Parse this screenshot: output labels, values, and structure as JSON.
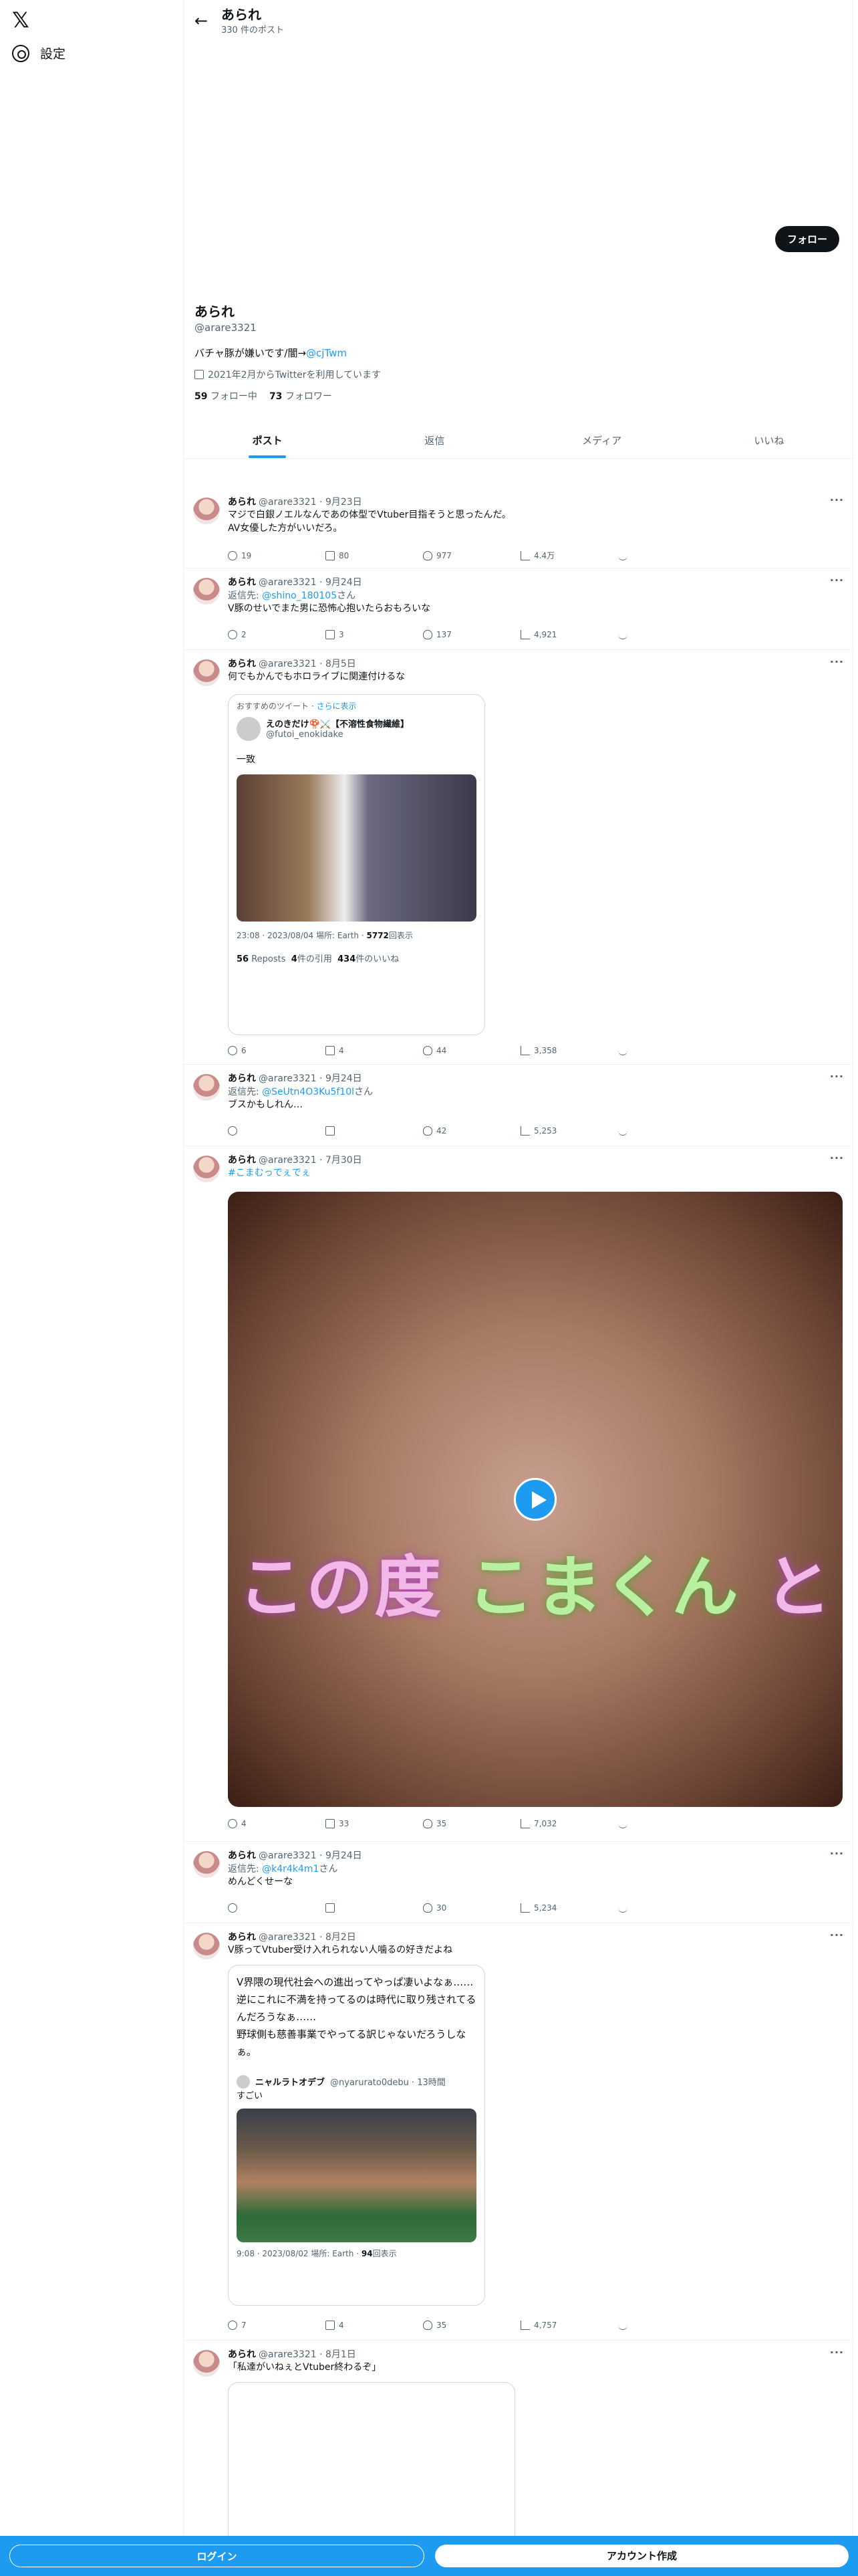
{
  "sidebar": {
    "settings": "設定"
  },
  "header": {
    "name": "あられ",
    "count": "330 件のポスト"
  },
  "profile": {
    "follow": "フォロー",
    "name": "あられ",
    "handle": "@arare3321",
    "bio": "バチャ豚が嫌いです/闇→",
    "bio_link": "@cjTwm",
    "joined": "2021年2月からTwitterを利用しています",
    "following_n": "59",
    "following": "フォロー中",
    "followers_n": "73",
    "followers": "フォロワー"
  },
  "tabs": [
    "ポスト",
    "返信",
    "メディア",
    "いいね"
  ],
  "tweets": [
    {
      "name": "あられ",
      "meta": "@arare3321 · 9月23日",
      "text1": "マジで白銀ノエルなんであの体型でVtuber目指そうと思ったんだ。",
      "text2": "AV女優した方がいいだろ。",
      "r": "19",
      "rt": "80",
      "l": "977",
      "v": "4.4万"
    },
    {
      "name": "あられ",
      "meta": "@arare3321 · 9月24日",
      "reply": "返信先: ",
      "reply_to": "@shino_180105",
      "san": "さん",
      "text1": "V豚のせいでまた男に恐怖心抱いたらおもろいな",
      "r": "2",
      "rt": "3",
      "l": "137",
      "v": "4,921"
    },
    {
      "name": "あられ",
      "meta": "@arare3321 · 8月5日",
      "text1": "何でもかんでもホロライブに関連付けるな",
      "r": "6",
      "rt": "4",
      "l": "44",
      "v": "3,358",
      "quote": {
        "rec": "おすすめのツイート · ",
        "rec_link": "さらに表示",
        "qname": "えのきだけ🍄⚔️【不溶性食物繊維】",
        "qhandle": "@futoi_enokidake",
        "qtext": "一致",
        "qmeta": "23:08 · 2023/08/04 場所: Earth · ",
        "views": "5772",
        "views_label": "回表示",
        "reposts": "56",
        "rp": "Reposts",
        "quotes": "4",
        "qt": "件の引用",
        "likes": "434",
        "lk": "件のいいね"
      }
    },
    {
      "name": "あられ",
      "meta": "@arare3321 · 9月24日",
      "reply": "返信先: ",
      "reply_to": "@SeUtn4O3Ku5f10l",
      "san": "さん",
      "text1": "ブスかもしれん…",
      "r": "",
      "rt": "",
      "l": "42",
      "v": "5,253"
    },
    {
      "name": "あられ",
      "meta": "@arare3321 · 7月30日",
      "hashtag": "#こまむっでぇでぇ",
      "video_text_a": "この度",
      "video_text_b": "こまくん",
      "video_text_c": "と",
      "r": "4",
      "rt": "33",
      "l": "35",
      "v": "7,032"
    },
    {
      "name": "あられ",
      "meta": "@arare3321 · 9月24日",
      "reply": "返信先: ",
      "reply_to": "@k4r4k4m1",
      "san": "さん",
      "text1": "めんどくせーな",
      "r": "",
      "rt": "",
      "l": "30",
      "v": "5,234"
    },
    {
      "name": "あられ",
      "meta": "@arare3321 · 8月2日",
      "text1": "V豚ってVtuber受け入れられない人噛るの好きだよね",
      "r": "7",
      "rt": "4",
      "l": "35",
      "v": "4,757",
      "quote": {
        "qtext1": "V界隈の現代社会への進出ってやっぱ凄いよなぁ……",
        "qtext2": "逆にこれに不満を持ってるのは時代に取り残されてるんだろうなぁ……",
        "qtext3": "野球側も慈善事業でやってる訳じゃないだろうしなぁ。",
        "qname": "ニャルラトオデブ",
        "qhandle": "@nyarurato0debu · 13時間",
        "qtext4": "すごい",
        "qmeta": "9:08 · 2023/08/02 場所: Earth · ",
        "views": "94",
        "views_label": "回表示"
      }
    },
    {
      "name": "あられ",
      "meta": "@arare3321 · 8月1日",
      "text1": "「私達がいねぇとVtuber終わるぞ」"
    }
  ],
  "bottom": {
    "login": "ログイン",
    "signup": "アカウント作成"
  }
}
